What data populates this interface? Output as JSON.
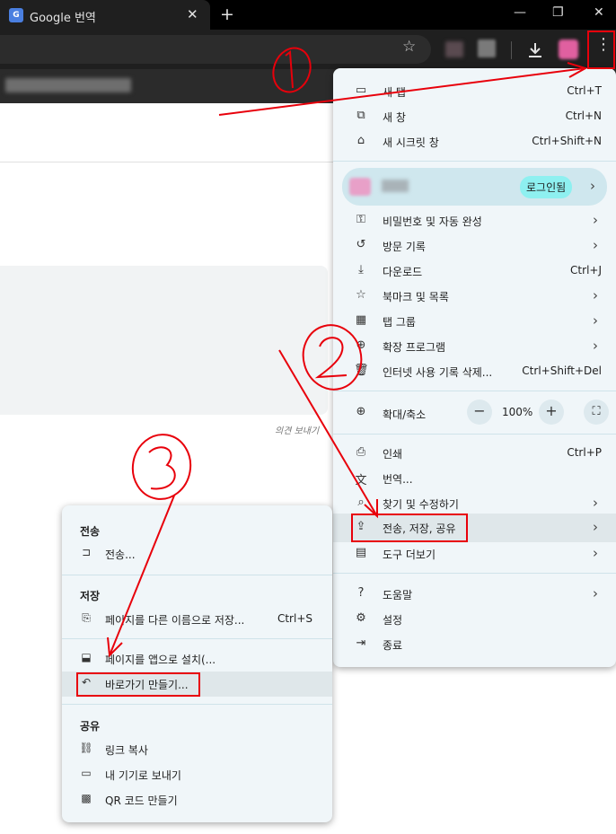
{
  "tab": {
    "title": "Google 번역",
    "favicon_text": "G",
    "close_icon": "close-icon",
    "new_tab": "+"
  },
  "window_controls": {
    "minimize": "—",
    "restore": "❐",
    "close": "✕"
  },
  "menu_dots": "⋮",
  "feedback": "의견 보내기",
  "main_menu": {
    "items": [
      {
        "icon": "new-tab-icon",
        "glyph": "▭",
        "label": "새 탭",
        "shortcut": "Ctrl+T"
      },
      {
        "icon": "new-window-icon",
        "glyph": "⧉",
        "label": "새 창",
        "shortcut": "Ctrl+N"
      },
      {
        "icon": "incognito-icon",
        "glyph": "⌂",
        "label": "새 시크릿 창",
        "shortcut": "Ctrl+Shift+N"
      }
    ],
    "profile": {
      "login_label": "로그인됨",
      "arrow": "›"
    },
    "items2": [
      {
        "icon": "key-icon",
        "glyph": "⚿",
        "label": "비밀번호 및 자동 완성",
        "arrow": "›"
      },
      {
        "icon": "history-icon",
        "glyph": "↺",
        "label": "방문 기록",
        "arrow": "›"
      },
      {
        "icon": "download-icon",
        "glyph": "⤓",
        "label": "다운로드",
        "shortcut": "Ctrl+J"
      },
      {
        "icon": "bookmark-star-icon",
        "glyph": "☆",
        "label": "북마크 및 목록",
        "arrow": "›"
      },
      {
        "icon": "tab-groups-icon",
        "glyph": "▦",
        "label": "탭 그룹",
        "arrow": "›"
      },
      {
        "icon": "extensions-icon",
        "glyph": "⊕",
        "label": "확장 프로그램",
        "arrow": "›"
      },
      {
        "icon": "trash-icon",
        "glyph": "🗑",
        "label": "인터넷 사용 기록 삭제...",
        "shortcut": "Ctrl+Shift+Del"
      }
    ],
    "zoom": {
      "label": "확대/축소",
      "minus": "−",
      "level": "100%",
      "plus": "+",
      "fullscreen": "⛶"
    },
    "items3": [
      {
        "icon": "print-icon",
        "glyph": "⎙",
        "label": "인쇄",
        "shortcut": "Ctrl+P"
      },
      {
        "icon": "translate-icon",
        "glyph": "文",
        "label": "번역..."
      },
      {
        "icon": "find-icon",
        "glyph": "⌕",
        "label": "찾기 및 수정하기",
        "arrow": "›"
      },
      {
        "icon": "share-icon",
        "glyph": "⇪",
        "label": "전송, 저장, 공유",
        "arrow": "›"
      },
      {
        "icon": "toolbox-icon",
        "glyph": "▤",
        "label": "도구 더보기",
        "arrow": "›"
      }
    ],
    "items4": [
      {
        "icon": "help-icon",
        "glyph": "?",
        "label": "도움말",
        "arrow": "›"
      },
      {
        "icon": "settings-icon",
        "glyph": "⚙",
        "label": "설정"
      },
      {
        "icon": "exit-icon",
        "glyph": "⇥",
        "label": "종료"
      }
    ]
  },
  "sub_menu": {
    "cast_header": "전송",
    "cast_item": {
      "icon": "cast-icon",
      "glyph": "⊐",
      "label": "전송..."
    },
    "save_header": "저장",
    "save_item": {
      "icon": "save-page-icon",
      "glyph": "⎘",
      "label": "페이지를 다른 이름으로 저장...",
      "shortcut": "Ctrl+S"
    },
    "install_item": {
      "icon": "install-app-icon",
      "glyph": "⬓",
      "label": "페이지를 앱으로 설치(..."
    },
    "shortcut_item": {
      "icon": "shortcut-icon",
      "glyph": "↶",
      "label": "바로가기 만들기..."
    },
    "share_header": "공유",
    "share_items": [
      {
        "icon": "link-icon",
        "glyph": "⛓",
        "label": "링크 복사"
      },
      {
        "icon": "devices-icon",
        "glyph": "▭",
        "label": "내 기기로 보내기"
      },
      {
        "icon": "qr-icon",
        "glyph": "▩",
        "label": "QR 코드 만들기"
      }
    ]
  },
  "annotation_colors": {
    "red": "#e8000b"
  }
}
